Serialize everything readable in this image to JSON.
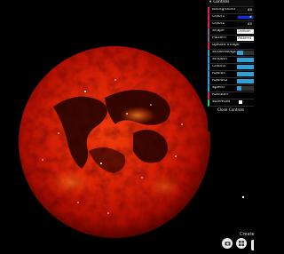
{
  "controls": {
    "header": "Controls",
    "rows": [
      {
        "label": "Background",
        "type": "color",
        "value": "#0",
        "color": "#111111"
      },
      {
        "label": "Color1",
        "type": "color",
        "value": "#",
        "color": "#0e2fd6"
      },
      {
        "label": "Color2",
        "type": "color",
        "value": "#0",
        "color": "#000000"
      },
      {
        "label": "Shape",
        "type": "select",
        "value": "Uniform"
      },
      {
        "label": "Pattern",
        "type": "select",
        "value": "Pattern4"
      },
      {
        "label": "Upload Image",
        "type": "button"
      },
      {
        "label": "StrokeWeight",
        "type": "slider",
        "value": 0.35
      },
      {
        "label": "Smooth",
        "type": "slider",
        "value": 1.0
      },
      {
        "label": "Counts",
        "type": "slider",
        "value": 1.0
      },
      {
        "label": "Radius",
        "type": "slider",
        "value": 1.0
      },
      {
        "label": "Radius2",
        "type": "slider",
        "value": 1.0
      },
      {
        "label": "Speed",
        "type": "slider",
        "value": 0.25
      },
      {
        "label": "Random",
        "type": "button"
      },
      {
        "label": "SaveRGB",
        "type": "checkbox"
      }
    ],
    "close_label": "Close Controls"
  },
  "credit_text": "Create",
  "planet": {
    "base_color": "#e02a06",
    "dark_color": "#1b0000",
    "light_color": "#ff6a1a"
  }
}
